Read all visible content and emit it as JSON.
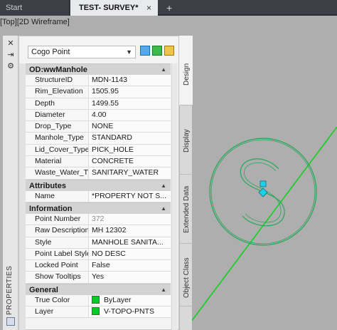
{
  "tabs": {
    "start": "Start",
    "active": "TEST- SURVEY*",
    "close": "×",
    "add": "+"
  },
  "viewport_label": "[Top][2D Wireframe]",
  "palette": {
    "side_label": "PROPERTIES",
    "object_type": "Cogo Point",
    "vertical_tabs": [
      "Design",
      "Display",
      "Extended Data",
      "Object Class"
    ],
    "categories": [
      {
        "title": "OD:wwManhole",
        "rows": [
          {
            "key": "StructureID",
            "value": "MDN-1143"
          },
          {
            "key": "Rim_Elevation",
            "value": "1505.95"
          },
          {
            "key": "Depth",
            "value": "1499.55"
          },
          {
            "key": "Diameter",
            "value": "4.00"
          },
          {
            "key": "Drop_Type",
            "value": "NONE"
          },
          {
            "key": "Manhole_Type",
            "value": "STANDARD"
          },
          {
            "key": "Lid_Cover_Type",
            "value": "PICK_HOLE"
          },
          {
            "key": "Material",
            "value": "CONCRETE"
          },
          {
            "key": "Waste_Water_Type",
            "value": "SANITARY_WATER"
          }
        ]
      },
      {
        "title": "Attributes",
        "rows": [
          {
            "key": "Name",
            "value": "*PROPERTY NOT S..."
          }
        ]
      },
      {
        "title": "Information",
        "rows": [
          {
            "key": "Point Number",
            "value": "372",
            "dim": true
          },
          {
            "key": "Raw Description",
            "value": "MH 12302"
          },
          {
            "key": "Style",
            "value": "MANHOLE SANITA..."
          },
          {
            "key": "Point Label Style",
            "value": "NO DESC"
          },
          {
            "key": "Locked Point",
            "value": "False"
          },
          {
            "key": "Show Tooltips",
            "value": "Yes"
          }
        ]
      },
      {
        "title": "General",
        "rows": [
          {
            "key": "True Color",
            "value": "ByLayer",
            "swatch": "#13c71f"
          },
          {
            "key": "Layer",
            "value": "V-TOPO-PNTS",
            "swatch": "#13c71f"
          }
        ]
      }
    ]
  },
  "colors": {
    "linework": "#11d11a",
    "manhole_symbol": "#26a65a",
    "grip": "#19d3e8",
    "background": "#aeaeae"
  }
}
